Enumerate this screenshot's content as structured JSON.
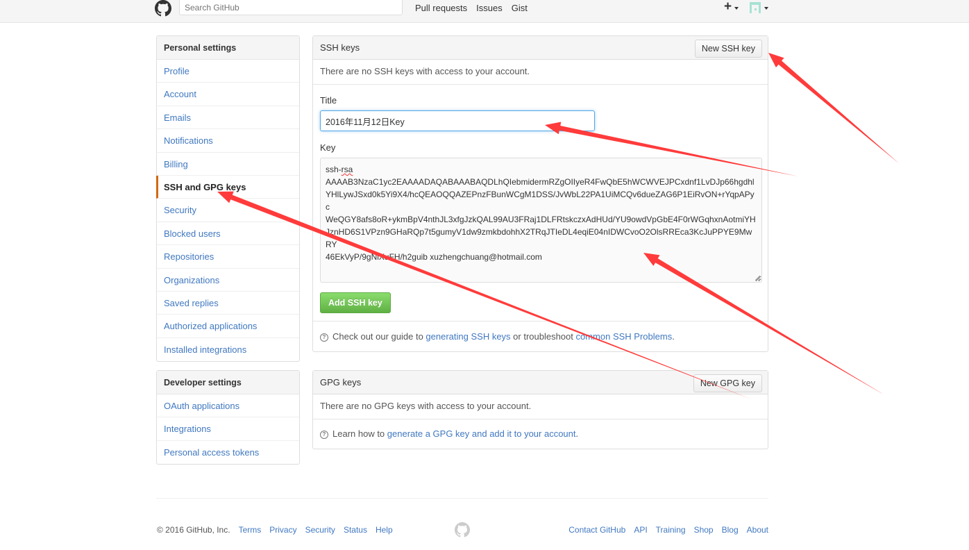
{
  "header": {
    "logo_icon": "github-octocat-icon",
    "search_placeholder": "Search GitHub",
    "nav": [
      "Pull requests",
      "Issues",
      "Gist"
    ],
    "plus_icon": "plus-icon",
    "avatar_icon": "identicon-avatar"
  },
  "sidebar": {
    "personal": {
      "title": "Personal settings",
      "items": [
        {
          "label": "Profile"
        },
        {
          "label": "Account"
        },
        {
          "label": "Emails"
        },
        {
          "label": "Notifications"
        },
        {
          "label": "Billing"
        },
        {
          "label": "SSH and GPG keys",
          "selected": true
        },
        {
          "label": "Security"
        },
        {
          "label": "Blocked users"
        },
        {
          "label": "Repositories"
        },
        {
          "label": "Organizations"
        },
        {
          "label": "Saved replies"
        },
        {
          "label": "Authorized applications"
        },
        {
          "label": "Installed integrations"
        }
      ]
    },
    "developer": {
      "title": "Developer settings",
      "items": [
        {
          "label": "OAuth applications"
        },
        {
          "label": "Integrations"
        },
        {
          "label": "Personal access tokens"
        }
      ]
    }
  },
  "ssh": {
    "title": "SSH keys",
    "new_button": "New SSH key",
    "empty_text": "There are no SSH keys with access to your account.",
    "form": {
      "title_label": "Title",
      "title_value": "2016年11月12日Key",
      "key_label": "Key",
      "key_value_lines": [
        "ssh-rsa",
        "AAAAB3NzaC1yc2EAAAADAQABAAABAQDLhQIebmidermRZgOIIyeR4FwQbE5hWCWVEJPCxdnf1LvDJp66hgdhl",
        "YHlLywJSxd0k5Yi9X4/hcQEAOQQAZEPnzFBunWCgM1DSS/JvWbL22PA1UiMCQv6dueZAG6P1EiRvON+rYqpAPyc",
        "WeQGY8afs8oR+ykmBpV4nthJL3xfgJzkQAL99AU3FRaj1DLFRtskczxAdHUd/YU9owdVpGbE4F0rWGqhxnAotmiYH",
        "JznHD6S1VPzn9GHaRQp7t5gumyV1dw9zmkbdohhX2TRqJTIeDL4eqiE04nIDWCvoO2OlsRREca3KcJuPPYE9MwRY",
        "46EkVyP/9gNlXuFH/h2guib xuzhengchuang@hotmail.com"
      ],
      "submit_button": "Add SSH key"
    },
    "help": {
      "prefix": "Check out our guide to ",
      "link1": "generating SSH keys",
      "middle": " or troubleshoot ",
      "link2": "common SSH Problems",
      "suffix": "."
    }
  },
  "gpg": {
    "title": "GPG keys",
    "new_button": "New GPG key",
    "empty_text": "There are no GPG keys with access to your account.",
    "help": {
      "prefix": "Learn how to ",
      "link": "generate a GPG key and add it to your account",
      "suffix": "."
    }
  },
  "footer": {
    "copyright": "© 2016 GitHub, Inc.",
    "left_links": [
      "Terms",
      "Privacy",
      "Security",
      "Status",
      "Help"
    ],
    "right_links": [
      "Contact GitHub",
      "API",
      "Training",
      "Shop",
      "Blog",
      "About"
    ]
  },
  "annotations": {
    "color": "#ff3b3b",
    "arrows": [
      "points-to-new-ssh-key-button",
      "points-to-title-input",
      "points-to-key-textarea",
      "points-to-sidebar-ssh-gpg-keys"
    ]
  }
}
